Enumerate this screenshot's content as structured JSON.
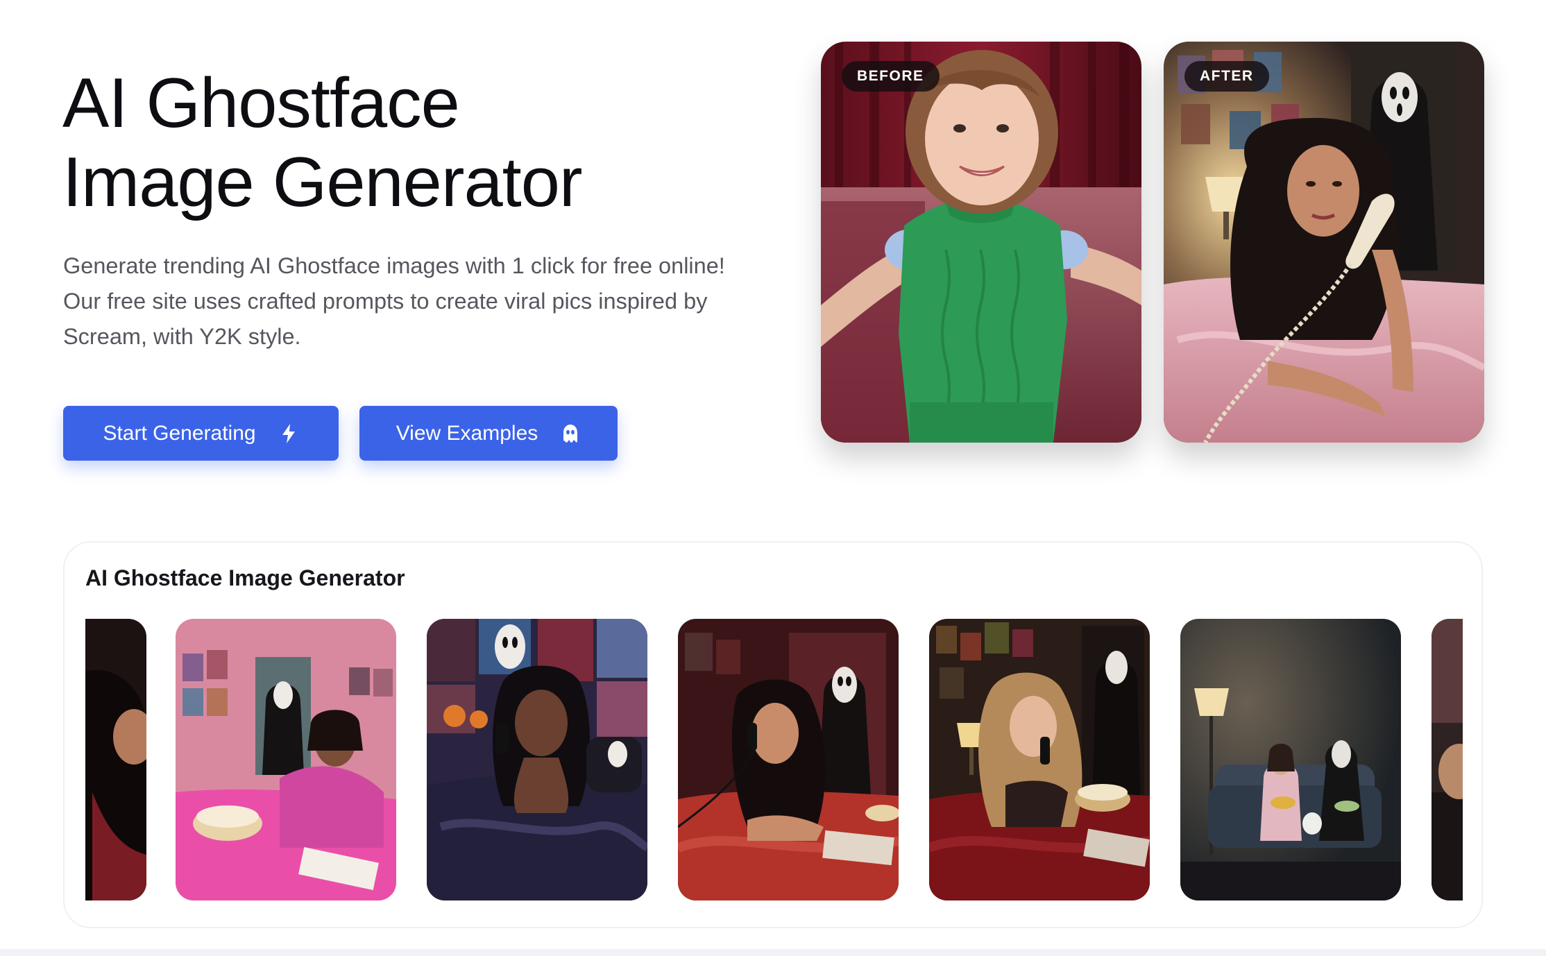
{
  "hero": {
    "title_line1": "AI Ghostface",
    "title_line2": "Image Generator",
    "description_line1": "Generate trending AI Ghostface images with 1 click for free online!",
    "description_line2": "Our free site uses crafted prompts to create viral pics inspired by",
    "description_line3": "Scream, with Y2K style.",
    "start_button": {
      "label": "Start Generating",
      "icon": "lightning-icon"
    },
    "examples_button": {
      "label": "View Examples",
      "icon": "ghost-icon"
    }
  },
  "comparison": {
    "before_label": "BEFORE",
    "after_label": "AFTER"
  },
  "gallery": {
    "title": "AI Ghostface Image Generator",
    "items": [
      {
        "scene": "partial dark-haired woman on phone"
      },
      {
        "scene": "pink bedroom with popcorn and ghostface"
      },
      {
        "scene": "purple satin bed with ghostface posters"
      },
      {
        "scene": "red bedroom with ghostface behind"
      },
      {
        "scene": "dark red bed with popcorn and ghostface"
      },
      {
        "scene": "couch with lamp, popcorn, dog and ghostface"
      },
      {
        "scene": "partial dark bedroom"
      }
    ]
  },
  "colors": {
    "accent": "#3b63e8",
    "text_dark": "#0d0d12",
    "text_muted": "#55565e"
  }
}
